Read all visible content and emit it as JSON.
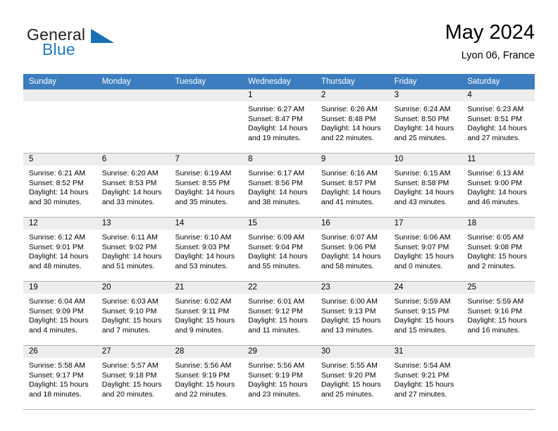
{
  "brand": {
    "name_part1": "General",
    "name_part2": "Blue",
    "logo_icon": "triangle-logo-icon"
  },
  "header": {
    "month_title": "May 2024",
    "location": "Lyon 06, France"
  },
  "calendar": {
    "accent_color": "#3c7dbf",
    "day_header_bg": "#ededed",
    "weekdays": [
      "Sunday",
      "Monday",
      "Tuesday",
      "Wednesday",
      "Thursday",
      "Friday",
      "Saturday"
    ],
    "labels": {
      "sunrise": "Sunrise:",
      "sunset": "Sunset:",
      "daylight": "Daylight:"
    },
    "weeks": [
      [
        {
          "day": "",
          "empty": true
        },
        {
          "day": "",
          "empty": true
        },
        {
          "day": "",
          "empty": true
        },
        {
          "day": "1",
          "sunrise": "Sunrise: 6:27 AM",
          "sunset": "Sunset: 8:47 PM",
          "daylight1": "Daylight: 14 hours",
          "daylight2": "and 19 minutes."
        },
        {
          "day": "2",
          "sunrise": "Sunrise: 6:26 AM",
          "sunset": "Sunset: 8:48 PM",
          "daylight1": "Daylight: 14 hours",
          "daylight2": "and 22 minutes."
        },
        {
          "day": "3",
          "sunrise": "Sunrise: 6:24 AM",
          "sunset": "Sunset: 8:50 PM",
          "daylight1": "Daylight: 14 hours",
          "daylight2": "and 25 minutes."
        },
        {
          "day": "4",
          "sunrise": "Sunrise: 6:23 AM",
          "sunset": "Sunset: 8:51 PM",
          "daylight1": "Daylight: 14 hours",
          "daylight2": "and 27 minutes."
        }
      ],
      [
        {
          "day": "5",
          "sunrise": "Sunrise: 6:21 AM",
          "sunset": "Sunset: 8:52 PM",
          "daylight1": "Daylight: 14 hours",
          "daylight2": "and 30 minutes."
        },
        {
          "day": "6",
          "sunrise": "Sunrise: 6:20 AM",
          "sunset": "Sunset: 8:53 PM",
          "daylight1": "Daylight: 14 hours",
          "daylight2": "and 33 minutes."
        },
        {
          "day": "7",
          "sunrise": "Sunrise: 6:19 AM",
          "sunset": "Sunset: 8:55 PM",
          "daylight1": "Daylight: 14 hours",
          "daylight2": "and 35 minutes."
        },
        {
          "day": "8",
          "sunrise": "Sunrise: 6:17 AM",
          "sunset": "Sunset: 8:56 PM",
          "daylight1": "Daylight: 14 hours",
          "daylight2": "and 38 minutes."
        },
        {
          "day": "9",
          "sunrise": "Sunrise: 6:16 AM",
          "sunset": "Sunset: 8:57 PM",
          "daylight1": "Daylight: 14 hours",
          "daylight2": "and 41 minutes."
        },
        {
          "day": "10",
          "sunrise": "Sunrise: 6:15 AM",
          "sunset": "Sunset: 8:58 PM",
          "daylight1": "Daylight: 14 hours",
          "daylight2": "and 43 minutes."
        },
        {
          "day": "11",
          "sunrise": "Sunrise: 6:13 AM",
          "sunset": "Sunset: 9:00 PM",
          "daylight1": "Daylight: 14 hours",
          "daylight2": "and 46 minutes."
        }
      ],
      [
        {
          "day": "12",
          "sunrise": "Sunrise: 6:12 AM",
          "sunset": "Sunset: 9:01 PM",
          "daylight1": "Daylight: 14 hours",
          "daylight2": "and 48 minutes."
        },
        {
          "day": "13",
          "sunrise": "Sunrise: 6:11 AM",
          "sunset": "Sunset: 9:02 PM",
          "daylight1": "Daylight: 14 hours",
          "daylight2": "and 51 minutes."
        },
        {
          "day": "14",
          "sunrise": "Sunrise: 6:10 AM",
          "sunset": "Sunset: 9:03 PM",
          "daylight1": "Daylight: 14 hours",
          "daylight2": "and 53 minutes."
        },
        {
          "day": "15",
          "sunrise": "Sunrise: 6:09 AM",
          "sunset": "Sunset: 9:04 PM",
          "daylight1": "Daylight: 14 hours",
          "daylight2": "and 55 minutes."
        },
        {
          "day": "16",
          "sunrise": "Sunrise: 6:07 AM",
          "sunset": "Sunset: 9:06 PM",
          "daylight1": "Daylight: 14 hours",
          "daylight2": "and 58 minutes."
        },
        {
          "day": "17",
          "sunrise": "Sunrise: 6:06 AM",
          "sunset": "Sunset: 9:07 PM",
          "daylight1": "Daylight: 15 hours",
          "daylight2": "and 0 minutes."
        },
        {
          "day": "18",
          "sunrise": "Sunrise: 6:05 AM",
          "sunset": "Sunset: 9:08 PM",
          "daylight1": "Daylight: 15 hours",
          "daylight2": "and 2 minutes."
        }
      ],
      [
        {
          "day": "19",
          "sunrise": "Sunrise: 6:04 AM",
          "sunset": "Sunset: 9:09 PM",
          "daylight1": "Daylight: 15 hours",
          "daylight2": "and 4 minutes."
        },
        {
          "day": "20",
          "sunrise": "Sunrise: 6:03 AM",
          "sunset": "Sunset: 9:10 PM",
          "daylight1": "Daylight: 15 hours",
          "daylight2": "and 7 minutes."
        },
        {
          "day": "21",
          "sunrise": "Sunrise: 6:02 AM",
          "sunset": "Sunset: 9:11 PM",
          "daylight1": "Daylight: 15 hours",
          "daylight2": "and 9 minutes."
        },
        {
          "day": "22",
          "sunrise": "Sunrise: 6:01 AM",
          "sunset": "Sunset: 9:12 PM",
          "daylight1": "Daylight: 15 hours",
          "daylight2": "and 11 minutes."
        },
        {
          "day": "23",
          "sunrise": "Sunrise: 6:00 AM",
          "sunset": "Sunset: 9:13 PM",
          "daylight1": "Daylight: 15 hours",
          "daylight2": "and 13 minutes."
        },
        {
          "day": "24",
          "sunrise": "Sunrise: 5:59 AM",
          "sunset": "Sunset: 9:15 PM",
          "daylight1": "Daylight: 15 hours",
          "daylight2": "and 15 minutes."
        },
        {
          "day": "25",
          "sunrise": "Sunrise: 5:59 AM",
          "sunset": "Sunset: 9:16 PM",
          "daylight1": "Daylight: 15 hours",
          "daylight2": "and 16 minutes."
        }
      ],
      [
        {
          "day": "26",
          "sunrise": "Sunrise: 5:58 AM",
          "sunset": "Sunset: 9:17 PM",
          "daylight1": "Daylight: 15 hours",
          "daylight2": "and 18 minutes."
        },
        {
          "day": "27",
          "sunrise": "Sunrise: 5:57 AM",
          "sunset": "Sunset: 9:18 PM",
          "daylight1": "Daylight: 15 hours",
          "daylight2": "and 20 minutes."
        },
        {
          "day": "28",
          "sunrise": "Sunrise: 5:56 AM",
          "sunset": "Sunset: 9:19 PM",
          "daylight1": "Daylight: 15 hours",
          "daylight2": "and 22 minutes."
        },
        {
          "day": "29",
          "sunrise": "Sunrise: 5:56 AM",
          "sunset": "Sunset: 9:19 PM",
          "daylight1": "Daylight: 15 hours",
          "daylight2": "and 23 minutes."
        },
        {
          "day": "30",
          "sunrise": "Sunrise: 5:55 AM",
          "sunset": "Sunset: 9:20 PM",
          "daylight1": "Daylight: 15 hours",
          "daylight2": "and 25 minutes."
        },
        {
          "day": "31",
          "sunrise": "Sunrise: 5:54 AM",
          "sunset": "Sunset: 9:21 PM",
          "daylight1": "Daylight: 15 hours",
          "daylight2": "and 27 minutes."
        },
        {
          "day": "",
          "empty": true
        }
      ]
    ]
  }
}
